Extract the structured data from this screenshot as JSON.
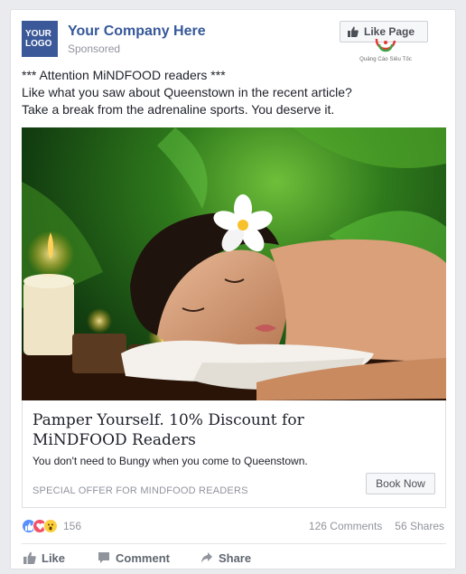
{
  "advertiser": {
    "logo_text_1": "YOUR",
    "logo_text_2": "LOGO",
    "name": "Your Company Here",
    "sponsored_label": "Sponsored",
    "like_page_label": "Like Page",
    "watermark_text": "Quảng Cáo Siêu Tốc"
  },
  "post": {
    "lines": [
      "*** Attention MiNDFOOD readers ***",
      "Like what you saw about Queenstown in the recent article?",
      "Take a break from the adrenaline sports. You deserve it."
    ]
  },
  "link": {
    "headline": "Pamper Yourself. 10% Discount for MiNDFOOD Readers",
    "description": "You don't need to Bungy when you come to Queenstown.",
    "caption": "SPECIAL OFFER FOR MINDFOOD READERS",
    "cta_label": "Book Now"
  },
  "engagement": {
    "reaction_count": "156",
    "comments": "126 Comments",
    "shares": "56 Shares"
  },
  "actions": {
    "like": "Like",
    "comment": "Comment",
    "share": "Share"
  },
  "colors": {
    "brand": "#3b5998",
    "link": "#365899",
    "muted": "#90949c"
  }
}
